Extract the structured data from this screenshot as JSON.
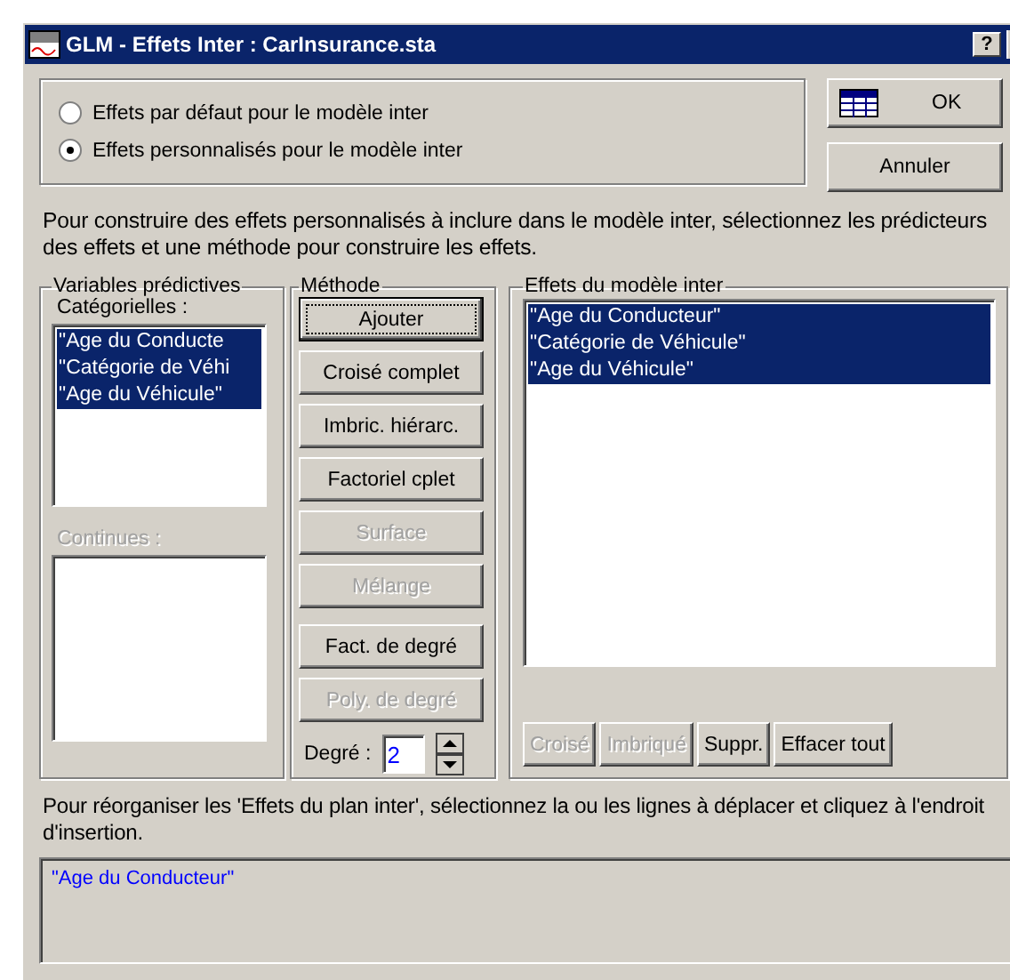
{
  "window": {
    "title": "GLM - Effets Inter : CarInsurance.sta",
    "help_button": "?"
  },
  "effect_mode": [
    {
      "label": "Effets par défaut pour le modèle inter",
      "selected": false
    },
    {
      "label": "Effets personnalisés pour le modèle inter",
      "selected": true
    }
  ],
  "dialog_buttons": [
    {
      "label": "OK",
      "kind": "ok"
    },
    {
      "label": "Annuler",
      "kind": "plain"
    }
  ],
  "instructions": [
    "Pour construire des effets personnalisés à inclure dans le modèle inter, sélectionnez les prédicteurs",
    "des effets et une méthode pour construire les effets."
  ],
  "predictors": {
    "title": "Variables prédictives",
    "categorical_label": "Catégorielles :",
    "categorical": [
      {
        "text": "\"Age du Conducte",
        "selected": true
      },
      {
        "text": "\"Catégorie de Véhi",
        "selected": true
      },
      {
        "text": "\"Age du Véhicule\"",
        "selected": true
      }
    ],
    "continuous_label": "Continues :",
    "continuous_disabled": true
  },
  "method": {
    "title": "Méthode",
    "buttons": [
      {
        "label": "Ajouter",
        "disabled": false,
        "focused": true
      },
      {
        "label": "Croisé complet",
        "disabled": false,
        "focused": false
      },
      {
        "label": "Imbric. hiérarc.",
        "disabled": false,
        "focused": false
      },
      {
        "label": "Factoriel cplet",
        "disabled": false,
        "focused": false
      },
      {
        "label": "Surface",
        "disabled": true,
        "focused": false
      },
      {
        "label": "Mélange",
        "disabled": true,
        "focused": false
      }
    ],
    "degree_buttons": [
      {
        "label": "Fact. de degré",
        "disabled": false,
        "focused": false
      },
      {
        "label": "Poly. de degré",
        "disabled": true,
        "focused": false
      }
    ],
    "degree_label": "Degré :",
    "degree_value": "2"
  },
  "effects": {
    "title": "Effets du modèle inter",
    "items": [
      {
        "text": "\"Age du Conducteur\"",
        "selected": true
      },
      {
        "text": "\"Catégorie de Véhicule\"",
        "selected": true
      },
      {
        "text": "\"Age du Véhicule\"",
        "selected": true
      }
    ],
    "buttons": [
      {
        "label": "Croisé",
        "disabled": true
      },
      {
        "label": "Imbriqué",
        "disabled": true
      },
      {
        "label": "Suppr.",
        "disabled": false
      },
      {
        "label": "Effacer tout",
        "disabled": false
      }
    ]
  },
  "reorder_hint": [
    "Pour réorganiser les 'Effets du plan inter', sélectionnez la ou les lignes à déplacer et cliquez à l'endroit",
    "d'insertion."
  ],
  "order_list": [
    "\"Age du Conducteur\""
  ]
}
